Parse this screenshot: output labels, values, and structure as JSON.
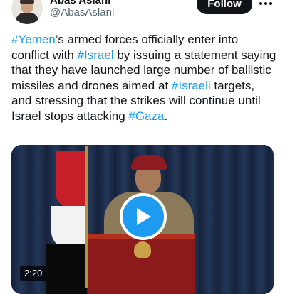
{
  "author": {
    "display_name": "Abas Aslani",
    "handle": "@AbasAslani"
  },
  "follow_label": "Follow",
  "tweet": {
    "segments": [
      {
        "text": "#Yemen",
        "hashtag": true
      },
      {
        "text": "’s armed forces officially enter into conflict with ",
        "hashtag": false
      },
      {
        "text": "#Israel",
        "hashtag": true
      },
      {
        "text": " by issuing a statement saying that they have launched large number of ballistic missiles and drones aimed at ",
        "hashtag": false
      },
      {
        "text": "#Israeli",
        "hashtag": true
      },
      {
        "text": " targets, and stressing that the strikes will continue until Israel stops attacking ",
        "hashtag": false
      },
      {
        "text": "#Gaza",
        "hashtag": true
      },
      {
        "text": ".",
        "hashtag": false
      }
    ]
  },
  "video": {
    "duration": "2:20",
    "play_icon": "play-icon"
  },
  "colors": {
    "hashtag": "#1d9bf0",
    "follow_bg": "#0f1419",
    "play_bg": "#1d9bf0"
  },
  "icons": {
    "more": "more-horizontal-icon",
    "play": "play-icon"
  }
}
